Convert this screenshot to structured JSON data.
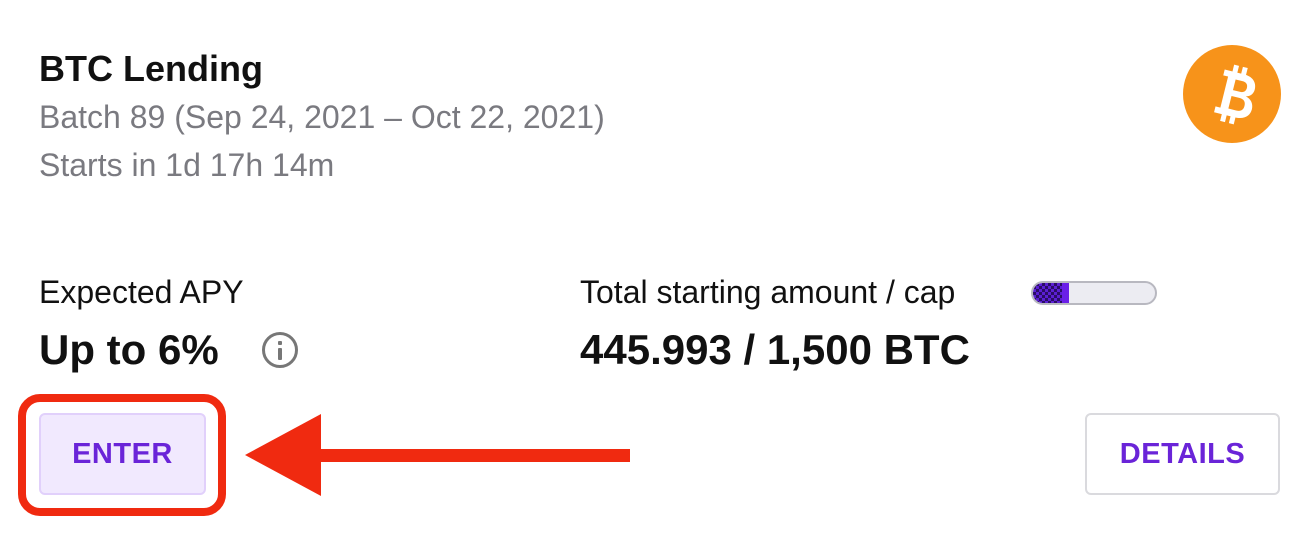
{
  "card": {
    "title": "BTC Lending",
    "batch": "Batch 89 (Sep 24, 2021 – Oct 22, 2021)",
    "starts_in": "Starts in 1d 17h 14m",
    "coin_icon": "bitcoin-icon",
    "coin_color": "#f7931a"
  },
  "apy": {
    "label": "Expected APY",
    "value": "Up to 6%",
    "info_icon": "info-icon"
  },
  "total": {
    "label": "Total starting amount / cap",
    "value": "445.993 / 1,500 BTC",
    "progress_fraction": 0.297
  },
  "actions": {
    "enter_label": "ENTER",
    "details_label": "DETAILS",
    "accent": "#6a24d8"
  },
  "annotation": {
    "highlight_color": "#f02a10",
    "arrow_icon": "left-arrow-icon"
  }
}
